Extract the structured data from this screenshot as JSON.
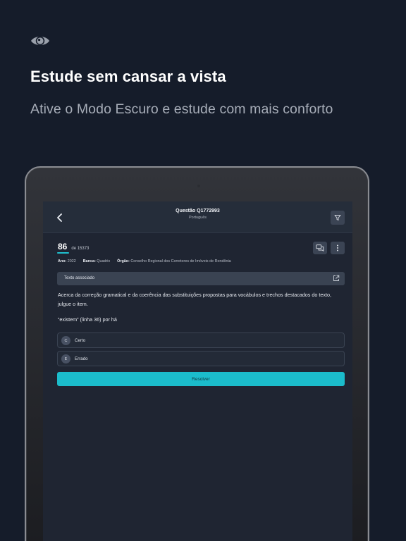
{
  "promo": {
    "headline": "Estude sem cansar a vista",
    "subheadline": "Ative o Modo Escuro e estude com mais conforto",
    "icon": "eye-icon"
  },
  "app": {
    "header": {
      "title": "Questão Q1772993",
      "subtitle": "Português",
      "back_icon": "chevron-left-icon",
      "filter_icon": "filter-icon"
    },
    "counter": {
      "current": "86",
      "total": "de 15373"
    },
    "actions": {
      "chat_icon": "chat-icon",
      "more_icon": "more-vertical-icon"
    },
    "meta": {
      "ano_label": "Ano:",
      "ano_value": "2022",
      "banca_label": "Banca:",
      "banca_value": "Quadrix",
      "orgao_label": "Órgão:",
      "orgao_value": "Conselho Regional dos Corretores de Imóveis de Rondônia"
    },
    "associated_text": {
      "label": "Texto associado",
      "icon": "external-link-icon"
    },
    "question": {
      "stem": "Acerca da correção gramatical e da coerência das substituições propostas para vocábulos e trechos destacados do texto, julgue o item.",
      "prompt": "“existem” (linha 36) por há"
    },
    "options": [
      {
        "letter": "C",
        "label": "Certo"
      },
      {
        "letter": "E",
        "label": "Errado"
      }
    ],
    "resolve_label": "Resolver"
  },
  "colors": {
    "background": "#151c2a",
    "accent": "#1bbccb",
    "panel": "#1f2532"
  }
}
